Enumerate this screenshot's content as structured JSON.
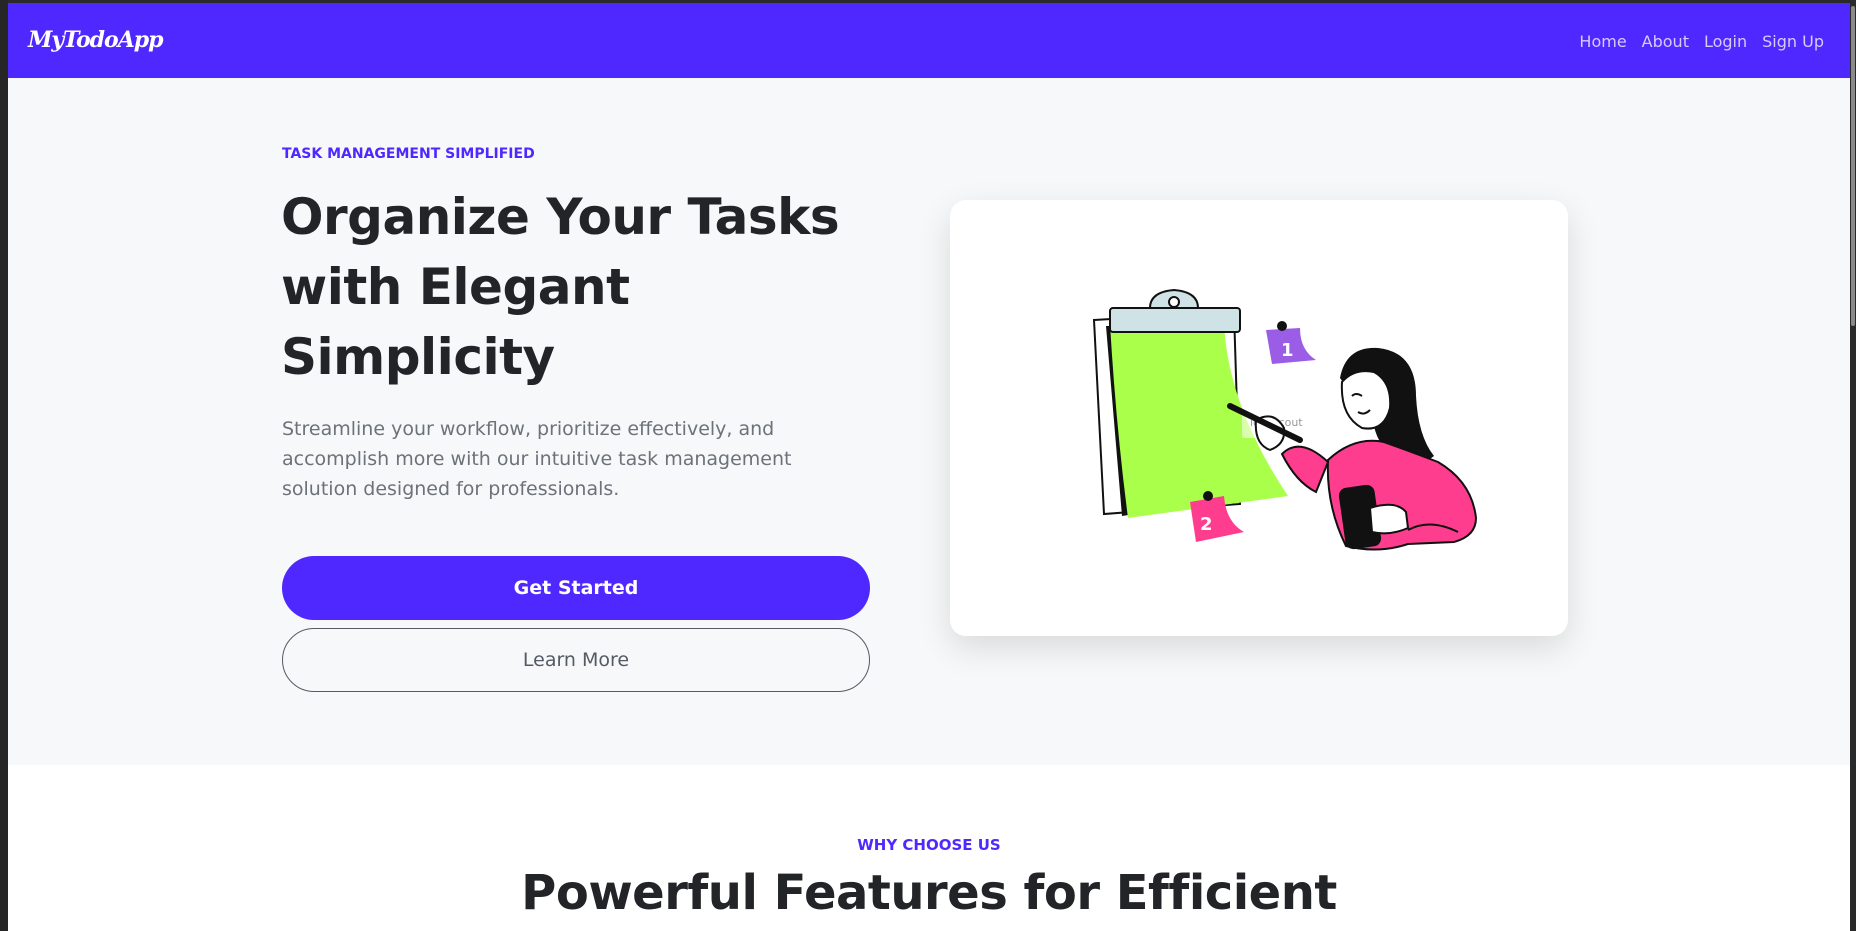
{
  "brand": {
    "name": "MyTodoApp"
  },
  "nav": {
    "links": [
      {
        "label": "Home"
      },
      {
        "label": "About"
      },
      {
        "label": "Login"
      },
      {
        "label": "Sign Up"
      }
    ]
  },
  "hero": {
    "eyebrow": "TASK MANAGEMENT SIMPLIFIED",
    "title": "Organize Your Tasks with Elegant Simplicity",
    "lead": "Streamline your workflow, prioritize effectively, and accomplish more with our intuitive task management solution designed for professionals.",
    "primary_button": "Get Started",
    "secondary_button": "Learn More",
    "illustration": {
      "note_1": "1",
      "note_2": "2",
      "watermark": "iconscout"
    }
  },
  "features": {
    "eyebrow": "WHY CHOOSE US",
    "title": "Powerful Features for Efficient"
  },
  "colors": {
    "accent": "#4f27ff",
    "heading": "#222428",
    "muted_text": "#6c727a",
    "clipboard_paper": "#aaff4a",
    "shirt": "#ff3d8e",
    "note_purple": "#9b5de5"
  },
  "icons": {
    "illustration": "clipboard-person-illustration"
  }
}
